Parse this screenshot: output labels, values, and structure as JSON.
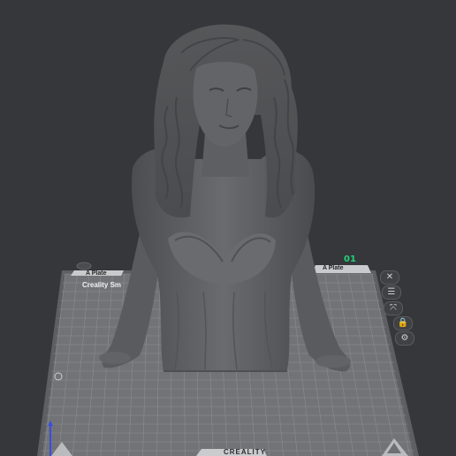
{
  "plate": {
    "left_tab_label": "A Plate",
    "right_tab_label": "A Plate",
    "number": "01",
    "printer_label": "Creality Sm",
    "brand": "CREALITY"
  },
  "toolbar": {
    "items": [
      {
        "name": "delete-plate-icon",
        "glyph": "✕"
      },
      {
        "name": "arrange-icon",
        "glyph": "☰"
      },
      {
        "name": "orient-icon",
        "glyph": "⤧"
      },
      {
        "name": "lock-icon",
        "glyph": "🔒"
      },
      {
        "name": "settings-icon",
        "glyph": "⚙"
      }
    ]
  },
  "colors": {
    "background": "#36373a",
    "bed": "#6f7174",
    "grid": "#8d8f92",
    "model": "#5f6063",
    "plate_number": "#20d07a"
  }
}
